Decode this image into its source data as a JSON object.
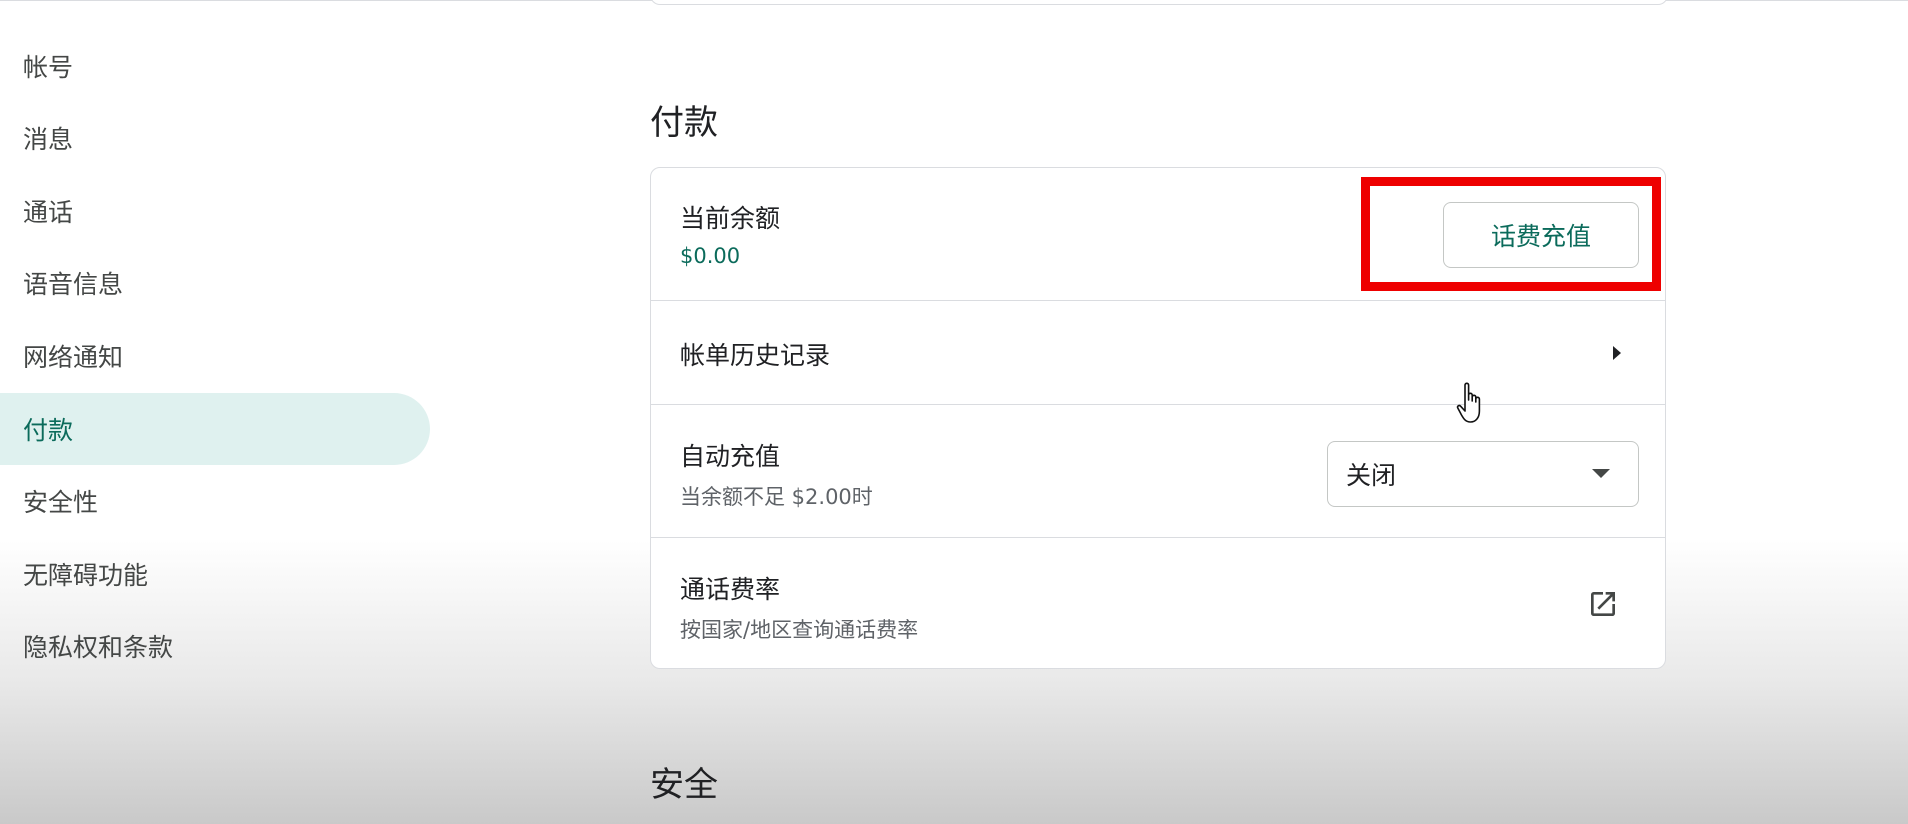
{
  "sidebar": {
    "items": [
      {
        "label": "帐号"
      },
      {
        "label": "消息"
      },
      {
        "label": "通话"
      },
      {
        "label": "语音信息"
      },
      {
        "label": "网络通知"
      },
      {
        "label": "付款",
        "active": true
      },
      {
        "label": "安全性"
      },
      {
        "label": "无障碍功能"
      },
      {
        "label": "隐私权和条款"
      }
    ]
  },
  "payment": {
    "title": "付款",
    "balance": {
      "label": "当前余额",
      "value": "$0.00",
      "topup_button": "话费充值"
    },
    "billing_history": {
      "label": "帐单历史记录"
    },
    "auto_recharge": {
      "label": "自动充值",
      "sublabel": "当余额不足 $2.00时",
      "selected": "关闭"
    },
    "call_rates": {
      "label": "通话费率",
      "sublabel": "按国家/地区查询通话费率"
    }
  },
  "security": {
    "title": "安全"
  },
  "colors": {
    "accent": "#0b6b5b",
    "active_bg": "#dff1ef",
    "highlight": "#ee0000"
  },
  "icons": {
    "billing_history": "chevron-right-icon",
    "auto_recharge": "caret-down-icon",
    "call_rates": "open-in-new-icon",
    "cursor": "hand-pointer-icon"
  }
}
